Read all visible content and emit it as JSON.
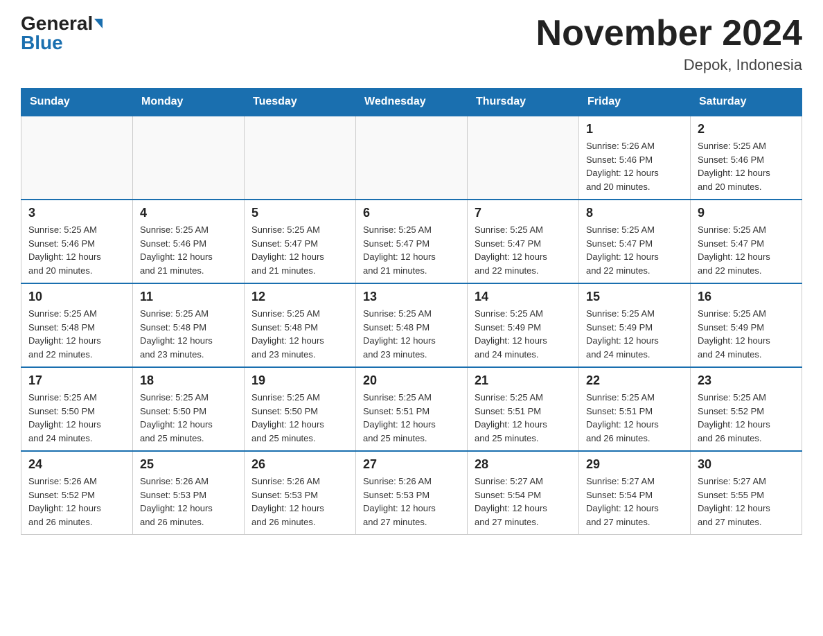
{
  "header": {
    "logo_general": "General",
    "logo_blue": "Blue",
    "month_title": "November 2024",
    "location": "Depok, Indonesia"
  },
  "weekdays": [
    "Sunday",
    "Monday",
    "Tuesday",
    "Wednesday",
    "Thursday",
    "Friday",
    "Saturday"
  ],
  "weeks": [
    [
      {
        "day": "",
        "info": ""
      },
      {
        "day": "",
        "info": ""
      },
      {
        "day": "",
        "info": ""
      },
      {
        "day": "",
        "info": ""
      },
      {
        "day": "",
        "info": ""
      },
      {
        "day": "1",
        "info": "Sunrise: 5:26 AM\nSunset: 5:46 PM\nDaylight: 12 hours\nand 20 minutes."
      },
      {
        "day": "2",
        "info": "Sunrise: 5:25 AM\nSunset: 5:46 PM\nDaylight: 12 hours\nand 20 minutes."
      }
    ],
    [
      {
        "day": "3",
        "info": "Sunrise: 5:25 AM\nSunset: 5:46 PM\nDaylight: 12 hours\nand 20 minutes."
      },
      {
        "day": "4",
        "info": "Sunrise: 5:25 AM\nSunset: 5:46 PM\nDaylight: 12 hours\nand 21 minutes."
      },
      {
        "day": "5",
        "info": "Sunrise: 5:25 AM\nSunset: 5:47 PM\nDaylight: 12 hours\nand 21 minutes."
      },
      {
        "day": "6",
        "info": "Sunrise: 5:25 AM\nSunset: 5:47 PM\nDaylight: 12 hours\nand 21 minutes."
      },
      {
        "day": "7",
        "info": "Sunrise: 5:25 AM\nSunset: 5:47 PM\nDaylight: 12 hours\nand 22 minutes."
      },
      {
        "day": "8",
        "info": "Sunrise: 5:25 AM\nSunset: 5:47 PM\nDaylight: 12 hours\nand 22 minutes."
      },
      {
        "day": "9",
        "info": "Sunrise: 5:25 AM\nSunset: 5:47 PM\nDaylight: 12 hours\nand 22 minutes."
      }
    ],
    [
      {
        "day": "10",
        "info": "Sunrise: 5:25 AM\nSunset: 5:48 PM\nDaylight: 12 hours\nand 22 minutes."
      },
      {
        "day": "11",
        "info": "Sunrise: 5:25 AM\nSunset: 5:48 PM\nDaylight: 12 hours\nand 23 minutes."
      },
      {
        "day": "12",
        "info": "Sunrise: 5:25 AM\nSunset: 5:48 PM\nDaylight: 12 hours\nand 23 minutes."
      },
      {
        "day": "13",
        "info": "Sunrise: 5:25 AM\nSunset: 5:48 PM\nDaylight: 12 hours\nand 23 minutes."
      },
      {
        "day": "14",
        "info": "Sunrise: 5:25 AM\nSunset: 5:49 PM\nDaylight: 12 hours\nand 24 minutes."
      },
      {
        "day": "15",
        "info": "Sunrise: 5:25 AM\nSunset: 5:49 PM\nDaylight: 12 hours\nand 24 minutes."
      },
      {
        "day": "16",
        "info": "Sunrise: 5:25 AM\nSunset: 5:49 PM\nDaylight: 12 hours\nand 24 minutes."
      }
    ],
    [
      {
        "day": "17",
        "info": "Sunrise: 5:25 AM\nSunset: 5:50 PM\nDaylight: 12 hours\nand 24 minutes."
      },
      {
        "day": "18",
        "info": "Sunrise: 5:25 AM\nSunset: 5:50 PM\nDaylight: 12 hours\nand 25 minutes."
      },
      {
        "day": "19",
        "info": "Sunrise: 5:25 AM\nSunset: 5:50 PM\nDaylight: 12 hours\nand 25 minutes."
      },
      {
        "day": "20",
        "info": "Sunrise: 5:25 AM\nSunset: 5:51 PM\nDaylight: 12 hours\nand 25 minutes."
      },
      {
        "day": "21",
        "info": "Sunrise: 5:25 AM\nSunset: 5:51 PM\nDaylight: 12 hours\nand 25 minutes."
      },
      {
        "day": "22",
        "info": "Sunrise: 5:25 AM\nSunset: 5:51 PM\nDaylight: 12 hours\nand 26 minutes."
      },
      {
        "day": "23",
        "info": "Sunrise: 5:25 AM\nSunset: 5:52 PM\nDaylight: 12 hours\nand 26 minutes."
      }
    ],
    [
      {
        "day": "24",
        "info": "Sunrise: 5:26 AM\nSunset: 5:52 PM\nDaylight: 12 hours\nand 26 minutes."
      },
      {
        "day": "25",
        "info": "Sunrise: 5:26 AM\nSunset: 5:53 PM\nDaylight: 12 hours\nand 26 minutes."
      },
      {
        "day": "26",
        "info": "Sunrise: 5:26 AM\nSunset: 5:53 PM\nDaylight: 12 hours\nand 26 minutes."
      },
      {
        "day": "27",
        "info": "Sunrise: 5:26 AM\nSunset: 5:53 PM\nDaylight: 12 hours\nand 27 minutes."
      },
      {
        "day": "28",
        "info": "Sunrise: 5:27 AM\nSunset: 5:54 PM\nDaylight: 12 hours\nand 27 minutes."
      },
      {
        "day": "29",
        "info": "Sunrise: 5:27 AM\nSunset: 5:54 PM\nDaylight: 12 hours\nand 27 minutes."
      },
      {
        "day": "30",
        "info": "Sunrise: 5:27 AM\nSunset: 5:55 PM\nDaylight: 12 hours\nand 27 minutes."
      }
    ]
  ]
}
